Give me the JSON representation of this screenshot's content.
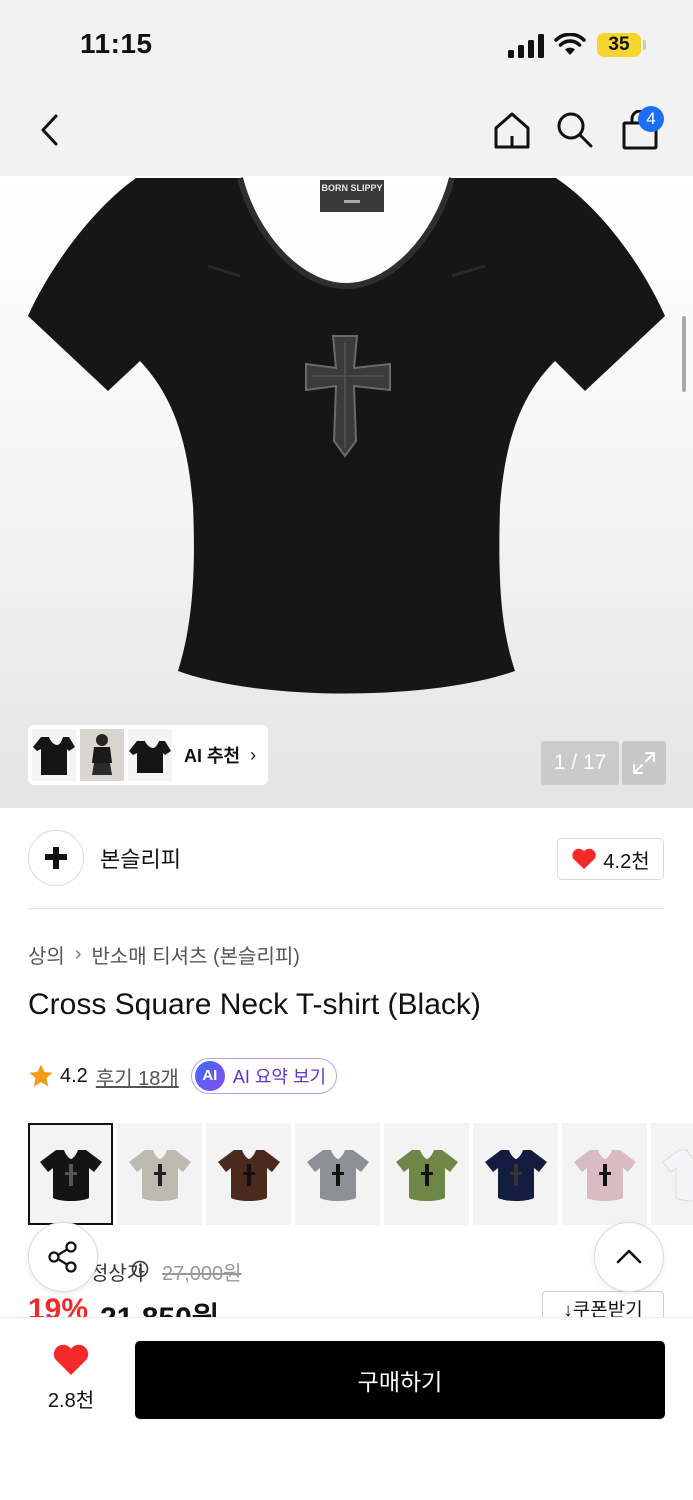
{
  "status_bar": {
    "time": "11:15",
    "battery": "35"
  },
  "nav": {
    "cart_count": "4"
  },
  "gallery": {
    "tag_text": "BORN SLIPPY",
    "ai_recommend_label": "AI 추천",
    "page_counter": "1 / 17"
  },
  "brand": {
    "name": "본슬리피",
    "likes": "4.2천"
  },
  "breadcrumb": {
    "level1": "상의",
    "level2": "반소매 티셔츠 (본슬리피)"
  },
  "product": {
    "title": "Cross Square Neck T-shirt (Black)",
    "rating": "4.2",
    "reviews": "후기 18개",
    "ai_badge": "AI",
    "ai_summary": "AI 요약 보기"
  },
  "swatch_colors": [
    "#141414",
    "#bdbab2",
    "#4a2a1c",
    "#8d9196",
    "#6e8747",
    "#141c3f",
    "#d9bcc3",
    "#f5f5f7"
  ],
  "price": {
    "label": "정상가",
    "original": "27,000원",
    "discount": "19%",
    "sale": "21,850원",
    "coupon": "쿠폰받기"
  },
  "bottom": {
    "likes": "2.8천",
    "buy_label": "구매하기"
  },
  "colors": {
    "accent_red": "#f22a2a",
    "badge_blue": "#1c6ff5",
    "ai_purple": "#6034d6"
  }
}
